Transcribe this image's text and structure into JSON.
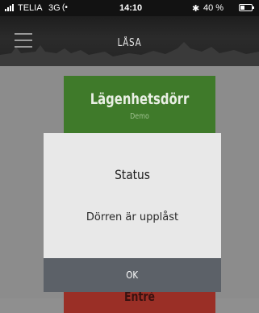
{
  "status_bar": {
    "carrier": "TELIA",
    "network": "3G",
    "time": "14:10",
    "battery_text": "40 %",
    "battery_level_fraction": 0.4,
    "icons": [
      "signal-icon",
      "activity-icon",
      "bluetooth-icon",
      "battery-icon"
    ]
  },
  "header": {
    "title": "LÅSA",
    "menu_icon": "hamburger-icon"
  },
  "cards": [
    {
      "title": "Lägenhetsdörr",
      "subtitle": "Demo",
      "color": "#3f7a2a"
    },
    {
      "title": "Entré",
      "color": "#9a2f26"
    }
  ],
  "dialog": {
    "title": "Status",
    "message": "Dörren är upplåst",
    "ok_label": "OK",
    "button_color": "#5c6168"
  }
}
